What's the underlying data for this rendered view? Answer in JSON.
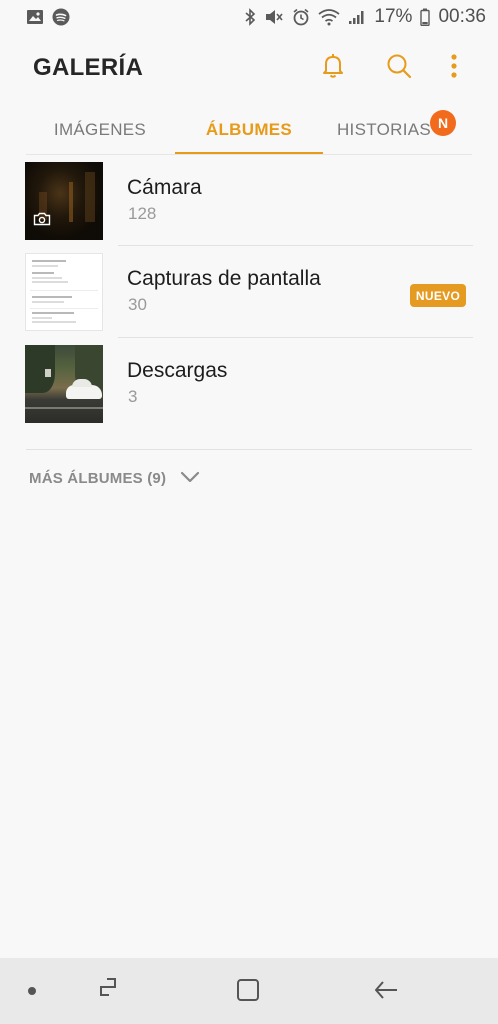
{
  "status_bar": {
    "battery_percent": "17%",
    "time": "00:36",
    "icons": [
      "image-icon",
      "spotify-icon",
      "bluetooth-icon",
      "mute-icon",
      "alarm-icon",
      "wifi-icon",
      "signal-icon",
      "battery-icon"
    ]
  },
  "header": {
    "title": "GALERÍA",
    "actions": [
      "bell-icon",
      "search-icon",
      "more-vert-icon"
    ]
  },
  "tabs": [
    {
      "label": "IMÁGENES",
      "active": false
    },
    {
      "label": "ÁLBUMES",
      "active": true
    },
    {
      "label": "HISTORIAS",
      "active": false,
      "badge": "N"
    }
  ],
  "albums": [
    {
      "name": "Cámara",
      "count": "128"
    },
    {
      "name": "Capturas de pantalla",
      "count": "30",
      "badge": "NUEVO"
    },
    {
      "name": "Descargas",
      "count": "3"
    }
  ],
  "more_albums": {
    "label": "MÁS ÁLBUMES (9)"
  },
  "colors": {
    "accent": "#e79b1a",
    "badge": "#f26a1b",
    "background": "#f8f8f8"
  }
}
